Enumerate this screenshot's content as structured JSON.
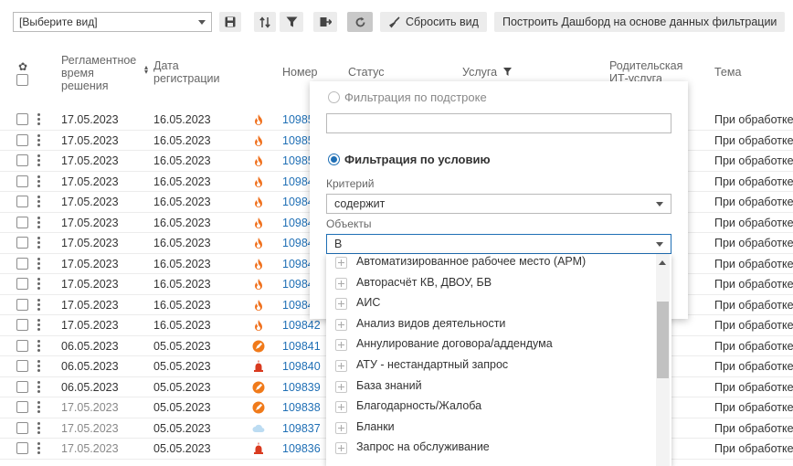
{
  "toolbar": {
    "view_select": "[Выберите вид]",
    "reset_view_label": "Сбросить вид",
    "build_dashboard_label": "Построить Дашборд на основе данных фильтрации"
  },
  "table": {
    "headers": {
      "deadline": [
        "Регламентное",
        "время",
        "решения"
      ],
      "reg_date": [
        "Дата",
        "регистрации"
      ],
      "number": "Номер",
      "status": "Статус",
      "service": "Услуга",
      "parent_service": [
        "Родительская",
        "ИТ-услуга"
      ],
      "topic": "Тема"
    },
    "rows": [
      {
        "deadline": "17.05.2023",
        "reg": "16.05.2023",
        "icon": "fire-icon",
        "num": "10985",
        "topic": "При обработке",
        "grey": false
      },
      {
        "deadline": "17.05.2023",
        "reg": "16.05.2023",
        "icon": "fire-icon",
        "num": "10985",
        "topic": "При обработке",
        "grey": false
      },
      {
        "deadline": "17.05.2023",
        "reg": "16.05.2023",
        "icon": "fire-icon",
        "num": "10985",
        "topic": "При обработке",
        "grey": false
      },
      {
        "deadline": "17.05.2023",
        "reg": "16.05.2023",
        "icon": "fire-icon",
        "num": "10984",
        "topic": "При обработке",
        "grey": false
      },
      {
        "deadline": "17.05.2023",
        "reg": "16.05.2023",
        "icon": "fire-icon",
        "num": "10984",
        "topic": "При обработке",
        "grey": false
      },
      {
        "deadline": "17.05.2023",
        "reg": "16.05.2023",
        "icon": "fire-icon",
        "num": "10984",
        "topic": "При обработке",
        "grey": false
      },
      {
        "deadline": "17.05.2023",
        "reg": "16.05.2023",
        "icon": "fire-icon",
        "num": "10984",
        "topic": "При обработке",
        "grey": false
      },
      {
        "deadline": "17.05.2023",
        "reg": "16.05.2023",
        "icon": "fire-icon",
        "num": "10984",
        "topic": "При обработке",
        "grey": false
      },
      {
        "deadline": "17.05.2023",
        "reg": "16.05.2023",
        "icon": "fire-icon",
        "num": "10984",
        "topic": "При обработке",
        "grey": false
      },
      {
        "deadline": "17.05.2023",
        "reg": "16.05.2023",
        "icon": "fire-icon",
        "num": "10984",
        "topic": "При обработке",
        "grey": false
      },
      {
        "deadline": "17.05.2023",
        "reg": "16.05.2023",
        "icon": "fire-icon",
        "num": "109842",
        "topic": "При обработке",
        "grey": false
      },
      {
        "deadline": "06.05.2023",
        "reg": "05.05.2023",
        "icon": "rocket-icon",
        "num": "109841",
        "topic": "При обработке",
        "grey": false
      },
      {
        "deadline": "06.05.2023",
        "reg": "05.05.2023",
        "icon": "alarm-icon",
        "num": "109840",
        "topic": "При обработке",
        "grey": false
      },
      {
        "deadline": "06.05.2023",
        "reg": "05.05.2023",
        "icon": "rocket-icon",
        "num": "109839",
        "topic": "При обработке",
        "grey": false
      },
      {
        "deadline": "17.05.2023",
        "reg": "05.05.2023",
        "icon": "rocket-icon",
        "num": "109838",
        "topic": "При обработке",
        "grey": true
      },
      {
        "deadline": "17.05.2023",
        "reg": "05.05.2023",
        "icon": "cloud-icon",
        "num": "109837",
        "topic": "При обработке",
        "grey": true
      },
      {
        "deadline": "17.05.2023",
        "reg": "05.05.2023",
        "icon": "alarm-icon",
        "num": "109836",
        "topic": "При обработке",
        "grey": true
      }
    ]
  },
  "filter": {
    "substring_label": "Фильтрация по подстроке",
    "substring_value": "",
    "condition_label": "Фильтрация по условию",
    "criterion_label": "Критерий",
    "criterion_value": "содержит",
    "objects_label": "Объекты",
    "objects_value": "В",
    "options": [
      "Автоматизированное рабочее место (АРМ)",
      "Авторасчёт КВ, ДВОУ, БВ",
      "АИС",
      "Анализ видов деятельности",
      "Аннулирование договора/аддендума",
      "АТУ - нестандартный запрос",
      "База знаний",
      "Благодарность/Жалоба",
      "Бланки",
      "Запрос на обслуживание"
    ]
  },
  "colors": {
    "link": "#1f6fb5",
    "fire": "#f0711e",
    "rocket": "#f07a1a",
    "alarm": "#d93a1f",
    "cloud": "#bcdcf2"
  }
}
